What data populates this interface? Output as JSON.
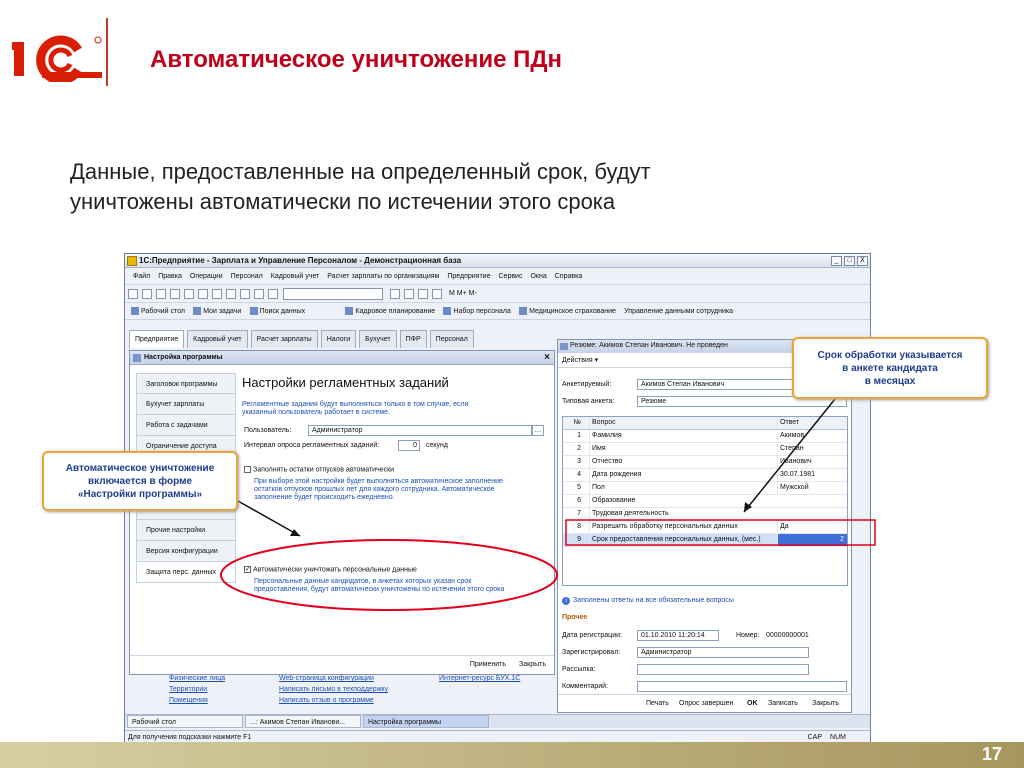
{
  "slide": {
    "title": "Автоматическое уничтожение ПДн",
    "lead": "Данные, предоставленные на определенный срок, будут уничтожены автоматически по истечении этого срока",
    "page_number": "17",
    "colors": {
      "title": "#c0001a",
      "callout_border": "#e9a43a",
      "callout_text": "#1f3c8f",
      "highlight": "#e3001b"
    }
  },
  "window": {
    "title": "1С:Предприятие - Зарплата и Управление Персоналом - Демонстрационная база",
    "controls": [
      "_",
      "□",
      "X"
    ]
  },
  "menu": [
    "Файл",
    "Правка",
    "Операции",
    "Персонал",
    "Кадровый учет",
    "Расчет зарплаты по организациям",
    "Предприятие",
    "Сервис",
    "Окна",
    "Справка"
  ],
  "toolbar": {
    "font_label": "M  M+  M-"
  },
  "panel": [
    "Рабочий стол",
    "Мои задачи",
    "Поиск данных",
    "Кадровое планирование",
    "Набор персонала",
    "Медицинское страхование",
    "Управление данными сотрудника"
  ],
  "section_tabs": [
    "Предприятие",
    "Кадровый учет",
    "Расчет зарплаты",
    "Налоги",
    "Бухучет",
    "ПФР",
    "Персонал"
  ],
  "settings": {
    "title": "Настройка программы",
    "sidebar": [
      "Заголовок программы",
      "Бухучет зарплаты",
      "Работа с задачами",
      "Ограничение доступа",
      "Прочие настройки",
      "Версия конфигурации",
      "Защита перс. данных"
    ],
    "heading": "Настройки регламентных заданий",
    "info": "Регламентные задания будут выполняться только в том случае, если указанный пользователь работает в системе.",
    "user_label": "Пользователь:",
    "user_value": "Администратор",
    "interval_label": "Интервал опроса регламентных заданий:",
    "interval_value": "0",
    "interval_unit": "секунд",
    "vacation_label": "Заполнять остатки отпусков автоматически",
    "vacation_desc": "При выборе этой настройки будет выполняться автоматическое заполнение остатков отпусков прошлых лет для каждого сотрудника. Автоматическое заполнение будет происходить ежедневно.",
    "destroy_label": "Автоматически уничтожать персональные данные",
    "destroy_desc": "Персональные данные кандидатов, в анкетах которых указан срок предоставления, будут автоматически уничтожены по истечении этого срока",
    "apply": "Применить",
    "close": "Закрыть"
  },
  "resume": {
    "title": "Резюме: Акимов Степан Иванович. Не проведен",
    "actions": "Действия",
    "applicant_label": "Анкетируемый:",
    "applicant_value": "Акимов Степан Иванович",
    "form_label": "Типовая анкета:",
    "form_value": "Резюме",
    "columns": [
      "№",
      "Вопрос",
      "Ответ"
    ],
    "rows": [
      [
        "1",
        "Фамилия",
        "Акимов"
      ],
      [
        "2",
        "Имя",
        "Степан"
      ],
      [
        "3",
        "Отчество",
        "Иванович"
      ],
      [
        "4",
        "Дата рождения",
        "30.07.1981"
      ],
      [
        "5",
        "Пол",
        "Мужской"
      ],
      [
        "6",
        "Образование",
        ""
      ],
      [
        "7",
        "Трудовая деятельность",
        ""
      ],
      [
        "8",
        "Разрешить обработку персональных данных",
        "Да"
      ],
      [
        "9",
        "Срок предоставления персональных данных, (мес.)",
        "2"
      ]
    ],
    "filled_note": "Заполнены ответы на все обязательные вопросы",
    "other_heading": "Прочее",
    "reg_date_label": "Дата регистрации:",
    "reg_date_value": "01.10.2010 11:20:14",
    "number_label": "Номер:",
    "number_value": "00000000001",
    "registered_label": "Зарегистрировал:",
    "registered_value": "Администратор",
    "mailing_label": "Рассылка:",
    "comment_label": "Комментарий:",
    "buttons": [
      "Печать",
      "Опрос завершен",
      "OK",
      "Записать",
      "Закрыть"
    ]
  },
  "links": {
    "col1": [
      "Физические лица",
      "Территории",
      "Помещения"
    ],
    "col2": [
      "Web-страница конфигурации",
      "Написать письмо в техподдержку",
      "Написать отзыв о программе"
    ],
    "col3": [
      "Интернет-ресурс БУХ.1С"
    ]
  },
  "taskbar": [
    "Рабочий стол",
    "...: Акимов Степан Иванови...",
    "Настройка программы"
  ],
  "status": {
    "hint": "Для получения подсказки нажмите F1",
    "cap": "CAP",
    "num": "NUM"
  },
  "callouts": {
    "left": [
      "Автоматическое уничтожение",
      "включается в форме",
      "«Настройки программы»"
    ],
    "right": [
      "Срок обработки указывается",
      "в анкете кандидата",
      "в месяцах"
    ]
  }
}
